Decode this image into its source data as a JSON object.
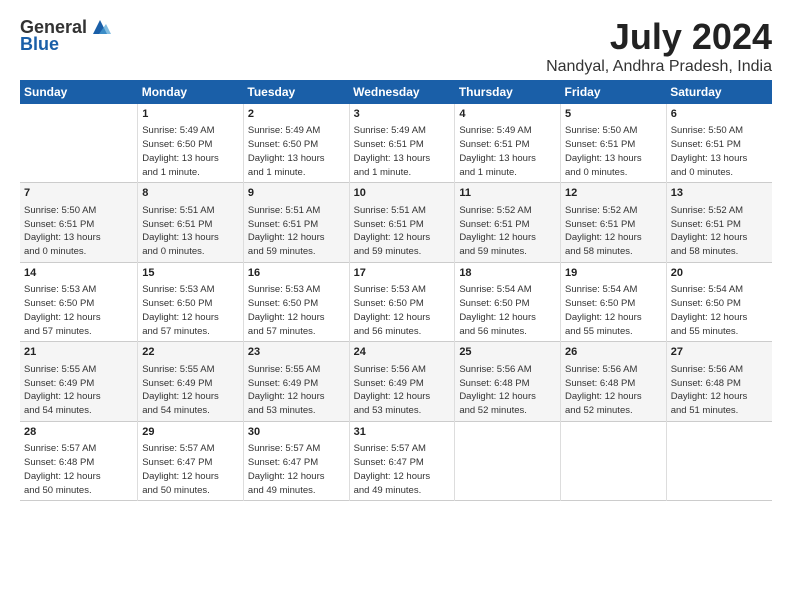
{
  "logo": {
    "general": "General",
    "blue": "Blue"
  },
  "title": "July 2024",
  "subtitle": "Nandyal, Andhra Pradesh, India",
  "headers": [
    "Sunday",
    "Monday",
    "Tuesday",
    "Wednesday",
    "Thursday",
    "Friday",
    "Saturday"
  ],
  "rows": [
    [
      {
        "day": "",
        "lines": []
      },
      {
        "day": "1",
        "lines": [
          "Sunrise: 5:49 AM",
          "Sunset: 6:50 PM",
          "Daylight: 13 hours",
          "and 1 minute."
        ]
      },
      {
        "day": "2",
        "lines": [
          "Sunrise: 5:49 AM",
          "Sunset: 6:50 PM",
          "Daylight: 13 hours",
          "and 1 minute."
        ]
      },
      {
        "day": "3",
        "lines": [
          "Sunrise: 5:49 AM",
          "Sunset: 6:51 PM",
          "Daylight: 13 hours",
          "and 1 minute."
        ]
      },
      {
        "day": "4",
        "lines": [
          "Sunrise: 5:49 AM",
          "Sunset: 6:51 PM",
          "Daylight: 13 hours",
          "and 1 minute."
        ]
      },
      {
        "day": "5",
        "lines": [
          "Sunrise: 5:50 AM",
          "Sunset: 6:51 PM",
          "Daylight: 13 hours",
          "and 0 minutes."
        ]
      },
      {
        "day": "6",
        "lines": [
          "Sunrise: 5:50 AM",
          "Sunset: 6:51 PM",
          "Daylight: 13 hours",
          "and 0 minutes."
        ]
      }
    ],
    [
      {
        "day": "7",
        "lines": [
          "Sunrise: 5:50 AM",
          "Sunset: 6:51 PM",
          "Daylight: 13 hours",
          "and 0 minutes."
        ]
      },
      {
        "day": "8",
        "lines": [
          "Sunrise: 5:51 AM",
          "Sunset: 6:51 PM",
          "Daylight: 13 hours",
          "and 0 minutes."
        ]
      },
      {
        "day": "9",
        "lines": [
          "Sunrise: 5:51 AM",
          "Sunset: 6:51 PM",
          "Daylight: 12 hours",
          "and 59 minutes."
        ]
      },
      {
        "day": "10",
        "lines": [
          "Sunrise: 5:51 AM",
          "Sunset: 6:51 PM",
          "Daylight: 12 hours",
          "and 59 minutes."
        ]
      },
      {
        "day": "11",
        "lines": [
          "Sunrise: 5:52 AM",
          "Sunset: 6:51 PM",
          "Daylight: 12 hours",
          "and 59 minutes."
        ]
      },
      {
        "day": "12",
        "lines": [
          "Sunrise: 5:52 AM",
          "Sunset: 6:51 PM",
          "Daylight: 12 hours",
          "and 58 minutes."
        ]
      },
      {
        "day": "13",
        "lines": [
          "Sunrise: 5:52 AM",
          "Sunset: 6:51 PM",
          "Daylight: 12 hours",
          "and 58 minutes."
        ]
      }
    ],
    [
      {
        "day": "14",
        "lines": [
          "Sunrise: 5:53 AM",
          "Sunset: 6:50 PM",
          "Daylight: 12 hours",
          "and 57 minutes."
        ]
      },
      {
        "day": "15",
        "lines": [
          "Sunrise: 5:53 AM",
          "Sunset: 6:50 PM",
          "Daylight: 12 hours",
          "and 57 minutes."
        ]
      },
      {
        "day": "16",
        "lines": [
          "Sunrise: 5:53 AM",
          "Sunset: 6:50 PM",
          "Daylight: 12 hours",
          "and 57 minutes."
        ]
      },
      {
        "day": "17",
        "lines": [
          "Sunrise: 5:53 AM",
          "Sunset: 6:50 PM",
          "Daylight: 12 hours",
          "and 56 minutes."
        ]
      },
      {
        "day": "18",
        "lines": [
          "Sunrise: 5:54 AM",
          "Sunset: 6:50 PM",
          "Daylight: 12 hours",
          "and 56 minutes."
        ]
      },
      {
        "day": "19",
        "lines": [
          "Sunrise: 5:54 AM",
          "Sunset: 6:50 PM",
          "Daylight: 12 hours",
          "and 55 minutes."
        ]
      },
      {
        "day": "20",
        "lines": [
          "Sunrise: 5:54 AM",
          "Sunset: 6:50 PM",
          "Daylight: 12 hours",
          "and 55 minutes."
        ]
      }
    ],
    [
      {
        "day": "21",
        "lines": [
          "Sunrise: 5:55 AM",
          "Sunset: 6:49 PM",
          "Daylight: 12 hours",
          "and 54 minutes."
        ]
      },
      {
        "day": "22",
        "lines": [
          "Sunrise: 5:55 AM",
          "Sunset: 6:49 PM",
          "Daylight: 12 hours",
          "and 54 minutes."
        ]
      },
      {
        "day": "23",
        "lines": [
          "Sunrise: 5:55 AM",
          "Sunset: 6:49 PM",
          "Daylight: 12 hours",
          "and 53 minutes."
        ]
      },
      {
        "day": "24",
        "lines": [
          "Sunrise: 5:56 AM",
          "Sunset: 6:49 PM",
          "Daylight: 12 hours",
          "and 53 minutes."
        ]
      },
      {
        "day": "25",
        "lines": [
          "Sunrise: 5:56 AM",
          "Sunset: 6:48 PM",
          "Daylight: 12 hours",
          "and 52 minutes."
        ]
      },
      {
        "day": "26",
        "lines": [
          "Sunrise: 5:56 AM",
          "Sunset: 6:48 PM",
          "Daylight: 12 hours",
          "and 52 minutes."
        ]
      },
      {
        "day": "27",
        "lines": [
          "Sunrise: 5:56 AM",
          "Sunset: 6:48 PM",
          "Daylight: 12 hours",
          "and 51 minutes."
        ]
      }
    ],
    [
      {
        "day": "28",
        "lines": [
          "Sunrise: 5:57 AM",
          "Sunset: 6:48 PM",
          "Daylight: 12 hours",
          "and 50 minutes."
        ]
      },
      {
        "day": "29",
        "lines": [
          "Sunrise: 5:57 AM",
          "Sunset: 6:47 PM",
          "Daylight: 12 hours",
          "and 50 minutes."
        ]
      },
      {
        "day": "30",
        "lines": [
          "Sunrise: 5:57 AM",
          "Sunset: 6:47 PM",
          "Daylight: 12 hours",
          "and 49 minutes."
        ]
      },
      {
        "day": "31",
        "lines": [
          "Sunrise: 5:57 AM",
          "Sunset: 6:47 PM",
          "Daylight: 12 hours",
          "and 49 minutes."
        ]
      },
      {
        "day": "",
        "lines": []
      },
      {
        "day": "",
        "lines": []
      },
      {
        "day": "",
        "lines": []
      }
    ]
  ]
}
